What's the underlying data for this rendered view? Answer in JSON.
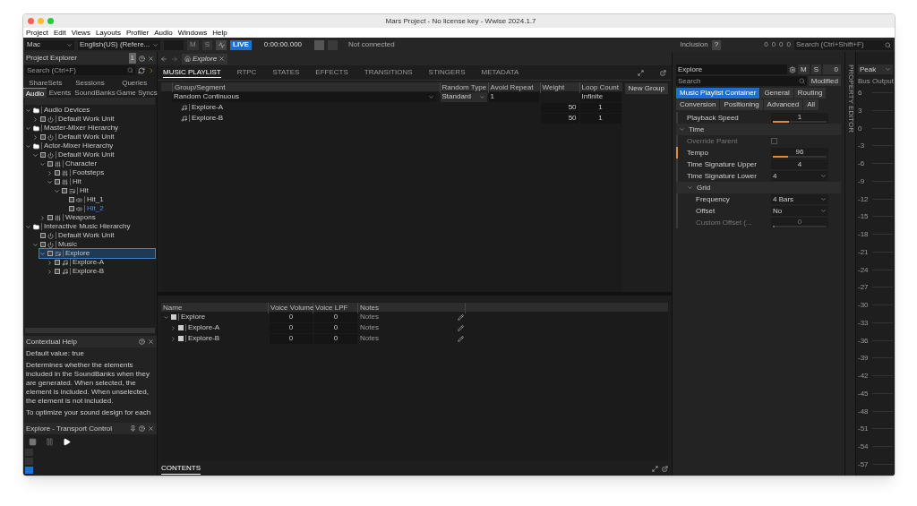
{
  "window": {
    "title": "Mars Project - No license key - Wwise 2024.1.7"
  },
  "menu": [
    "Project",
    "Edit",
    "Views",
    "Layouts",
    "Profiler",
    "Audio",
    "Windows",
    "Help"
  ],
  "toolbar": {
    "platform": "Mac",
    "language": "English(US) (Refere...",
    "mute": "M",
    "solo": "S",
    "live": "LIVE",
    "time": "0:00:00.000",
    "connection": "Not connected",
    "inclusion_label": "Inclusion",
    "inclusion_help": "?",
    "counts": [
      "0",
      "0",
      "0",
      "0"
    ],
    "search_placeholder": "Search (Ctrl+Shift+F)"
  },
  "project_explorer": {
    "title": "Project Explorer",
    "badge": "1",
    "search_placeholder": "Search (Ctrl+F)",
    "tabs_top": [
      {
        "label": "ShareSets",
        "selected": false
      },
      {
        "label": "Sessions",
        "selected": false
      },
      {
        "label": "Queries",
        "selected": false
      }
    ],
    "tabs_bottom": [
      {
        "label": "Audio",
        "selected": true
      },
      {
        "label": "Events",
        "selected": false
      },
      {
        "label": "SoundBanks",
        "selected": false
      },
      {
        "label": "Game Syncs",
        "selected": false
      }
    ],
    "tree": [
      {
        "label": "Audio Devices",
        "kind": "folder",
        "expanded": true,
        "selected": false,
        "highlighted": false,
        "children": [
          {
            "label": "Default Work Unit",
            "kind": "workunit",
            "expanded": false,
            "selected": false,
            "highlighted": false
          }
        ]
      },
      {
        "label": "Master-Mixer Hierarchy",
        "kind": "folder",
        "expanded": true,
        "selected": false,
        "highlighted": false,
        "children": [
          {
            "label": "Default Work Unit",
            "kind": "workunit",
            "expanded": false,
            "selected": false,
            "highlighted": false
          }
        ]
      },
      {
        "label": "Actor-Mixer Hierarchy",
        "kind": "folder",
        "expanded": true,
        "selected": false,
        "highlighted": false,
        "children": [
          {
            "label": "Default Work Unit",
            "kind": "workunit",
            "expanded": true,
            "selected": false,
            "highlighted": false,
            "children": [
              {
                "label": "Character",
                "kind": "mixer",
                "expanded": true,
                "selected": false,
                "highlighted": false,
                "children": [
                  {
                    "label": "Footsteps",
                    "kind": "mixer",
                    "expanded": false,
                    "selected": false,
                    "highlighted": false
                  },
                  {
                    "label": "Hit",
                    "kind": "mixer",
                    "expanded": true,
                    "selected": false,
                    "highlighted": false,
                    "children": [
                      {
                        "label": "Hit",
                        "kind": "container",
                        "expanded": true,
                        "selected": false,
                        "highlighted": false,
                        "children": [
                          {
                            "label": "Hit_1",
                            "kind": "sound",
                            "selected": false,
                            "highlighted": false
                          },
                          {
                            "label": "Hit_2",
                            "kind": "sound",
                            "selected": false,
                            "highlighted": true
                          }
                        ]
                      }
                    ]
                  }
                ]
              },
              {
                "label": "Weapons",
                "kind": "mixer",
                "expanded": false,
                "selected": false,
                "highlighted": false
              }
            ]
          }
        ]
      },
      {
        "label": "Interactive Music Hierarchy",
        "kind": "folder",
        "expanded": true,
        "selected": false,
        "highlighted": false,
        "children": [
          {
            "label": "Default Work Unit",
            "kind": "workunit",
            "selected": false,
            "highlighted": false
          },
          {
            "label": "Music",
            "kind": "workunit",
            "expanded": true,
            "selected": false,
            "highlighted": false,
            "children": [
              {
                "label": "Explore",
                "kind": "playlist",
                "expanded": true,
                "selected": true,
                "highlighted": false,
                "children": [
                  {
                    "label": "Explore-A",
                    "kind": "segment",
                    "expanded": false,
                    "selected": false,
                    "highlighted": false
                  },
                  {
                    "label": "Explore-B",
                    "kind": "segment",
                    "expanded": false,
                    "selected": false,
                    "highlighted": false
                  }
                ]
              }
            ]
          }
        ]
      }
    ]
  },
  "contextual_help": {
    "title": "Contextual Help",
    "paragraphs": [
      "Default value: true",
      "Determines whether the elements included in the SoundBanks when they are generated. When selected, the element is included. When unselected, the element is not included.",
      "To optimize your sound design for each"
    ]
  },
  "transport": {
    "title": "Explore - Transport Control"
  },
  "editor": {
    "tab": "Explore",
    "tabs": [
      {
        "label": "MUSIC PLAYLIST",
        "selected": true
      },
      {
        "label": "RTPC",
        "selected": false
      },
      {
        "label": "STATES",
        "selected": false
      },
      {
        "label": "EFFECTS",
        "selected": false
      },
      {
        "label": "TRANSITIONS",
        "selected": false
      },
      {
        "label": "STINGERS",
        "selected": false
      },
      {
        "label": "METADATA",
        "selected": false
      }
    ],
    "playlist": {
      "columns": [
        "Group/Segment",
        "Random Type",
        "Avoid Repeat",
        "Weight",
        "Loop Count"
      ],
      "group": {
        "name": "Random Continuous",
        "random_type": "Standard",
        "avoid_repeat": "1",
        "loop_count": "Infinite"
      },
      "segments": [
        {
          "name": "Explore-A",
          "weight": "50",
          "loop_count": "1"
        },
        {
          "name": "Explore-B",
          "weight": "50",
          "loop_count": "1"
        }
      ]
    },
    "new_group": "New Group",
    "contents": {
      "tab": "CONTENTS",
      "columns": [
        "Name",
        "Voice Volume",
        "Voice LPF",
        "Notes"
      ],
      "rows": [
        {
          "name": "Explore",
          "expanded": true,
          "volume": "0",
          "lpf": "0",
          "notes_placeholder": "Notes",
          "children": [
            {
              "name": "Explore-A",
              "expanded": false,
              "volume": "0",
              "lpf": "0",
              "notes_placeholder": "Notes"
            },
            {
              "name": "Explore-B",
              "expanded": false,
              "volume": "0",
              "lpf": "0",
              "notes_placeholder": "Notes"
            }
          ]
        }
      ]
    }
  },
  "property_editor": {
    "name": "Explore",
    "mute": "M",
    "solo": "S",
    "count": "0",
    "search_placeholder": "Search",
    "modified": "Modified",
    "side_label": "PROPERTY EDITOR",
    "tabs": [
      {
        "label": "Music Playlist Container",
        "selected": true
      },
      {
        "label": "General",
        "selected": false
      },
      {
        "label": "Routing",
        "selected": false
      },
      {
        "label": "Conversion",
        "selected": false
      },
      {
        "label": "Positioning",
        "selected": false
      },
      {
        "label": "Advanced",
        "selected": false
      },
      {
        "label": "All",
        "selected": false
      }
    ],
    "rows": [
      {
        "kind": "slider",
        "label": "Playback Speed",
        "value": "1",
        "level": 0.3,
        "modified": false,
        "disabled": false
      },
      {
        "kind": "section",
        "label": "Time",
        "expanded": true,
        "children": [
          {
            "kind": "checkbox",
            "label": "Override Parent",
            "checked": false,
            "modified": false,
            "disabled": true
          },
          {
            "kind": "slider",
            "label": "Tempo",
            "value": "96",
            "level": 0.28,
            "modified": true,
            "disabled": false
          },
          {
            "kind": "spinner",
            "label": "Time Signature Upper",
            "value": "4",
            "modified": false,
            "disabled": false
          },
          {
            "kind": "dropdown",
            "label": "Time Signature Lower",
            "value": "4",
            "modified": false,
            "disabled": false
          },
          {
            "kind": "section",
            "label": "Grid",
            "expanded": true,
            "children": [
              {
                "kind": "dropdown",
                "label": "Frequency",
                "value": "4 Bars",
                "modified": false,
                "disabled": false
              },
              {
                "kind": "dropdown",
                "label": "Offset",
                "value": "No",
                "modified": false,
                "disabled": false
              },
              {
                "kind": "slider",
                "label": "Custom Offset (...",
                "value": "0",
                "level": 0,
                "modified": false,
                "disabled": true
              }
            ]
          }
        ]
      }
    ]
  },
  "meter": {
    "mode": "Peak",
    "title": "Bus Output",
    "scale": [
      "6",
      "3",
      "0",
      "-3",
      "-6",
      "-9",
      "-12",
      "-15",
      "-18",
      "-21",
      "-24",
      "-27",
      "-30",
      "-33",
      "-36",
      "-39",
      "-42",
      "-45",
      "-48",
      "-51",
      "-54",
      "-57"
    ]
  }
}
